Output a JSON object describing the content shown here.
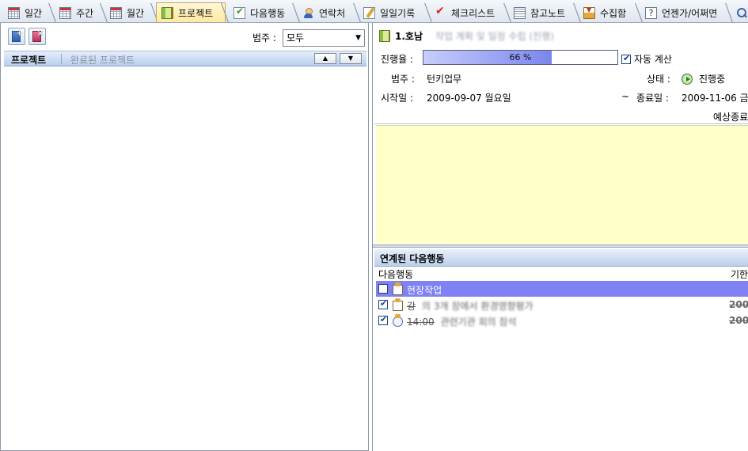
{
  "tabs": [
    {
      "label": "일간",
      "icon": "calendar-day-icon",
      "active": false
    },
    {
      "label": "주간",
      "icon": "calendar-week-icon",
      "active": false
    },
    {
      "label": "월간",
      "icon": "calendar-month-icon",
      "active": false
    },
    {
      "label": "프로젝트",
      "icon": "project-book-icon",
      "active": true
    },
    {
      "label": "다음행동",
      "icon": "next-action-icon",
      "active": false
    },
    {
      "label": "연락처",
      "icon": "contact-icon",
      "active": false
    },
    {
      "label": "일일기록",
      "icon": "journal-icon",
      "active": false
    },
    {
      "label": "체크리스트",
      "icon": "checklist-icon",
      "active": false
    },
    {
      "label": "참고노트",
      "icon": "reference-note-icon",
      "active": false
    },
    {
      "label": "수집함",
      "icon": "inbox-icon",
      "active": false
    },
    {
      "label": "언젠가/어쩌면",
      "icon": "someday-icon",
      "active": false
    }
  ],
  "left": {
    "category_label": "범주 :",
    "category_value": "모두",
    "header_projects": "프로젝트",
    "header_completed": "완료된 프로젝트",
    "sort_up": "▲",
    "sort_down": "▼"
  },
  "detail": {
    "title": "1.호남",
    "title_obscured": "작업 계획 및 일정 수립 (진행)",
    "progress_label": "진행율 :",
    "progress_value": 66,
    "progress_text": "66 %",
    "auto_calc_label": "자동 계산",
    "auto_calc_checked": true,
    "category_label": "범주 :",
    "category_value": "턴키업무",
    "status_label": "상태 :",
    "status_value": "진행중",
    "start_label": "시작일 :",
    "start_value": "2009-09-07 월요일",
    "range_sep": "~",
    "end_label": "종료일 :",
    "end_value": "2009-11-06 금",
    "expected_label": "예상종료"
  },
  "next_actions": {
    "header": "연계된 다음행동",
    "col_action": "다음행동",
    "col_due": "기한",
    "rows": [
      {
        "checked": false,
        "icon": "task-icon",
        "text": "현장작업",
        "obscured": "",
        "done": false,
        "due": "",
        "selected": true
      },
      {
        "checked": true,
        "icon": "task-icon",
        "text": "강",
        "obscured": "의 3개 장에서 환경영향평가",
        "done": true,
        "due": "200",
        "selected": false
      },
      {
        "checked": true,
        "icon": "clock-task-icon",
        "text": "14:00",
        "obscured": "관련기관 회의 참석",
        "done": true,
        "due": "200",
        "selected": false
      }
    ]
  },
  "colors": {
    "active_tab": "#ffe79b",
    "progress_fill": "#7a85ee",
    "memo_bg": "#ffffc8",
    "selected_row": "#7e82f2"
  }
}
